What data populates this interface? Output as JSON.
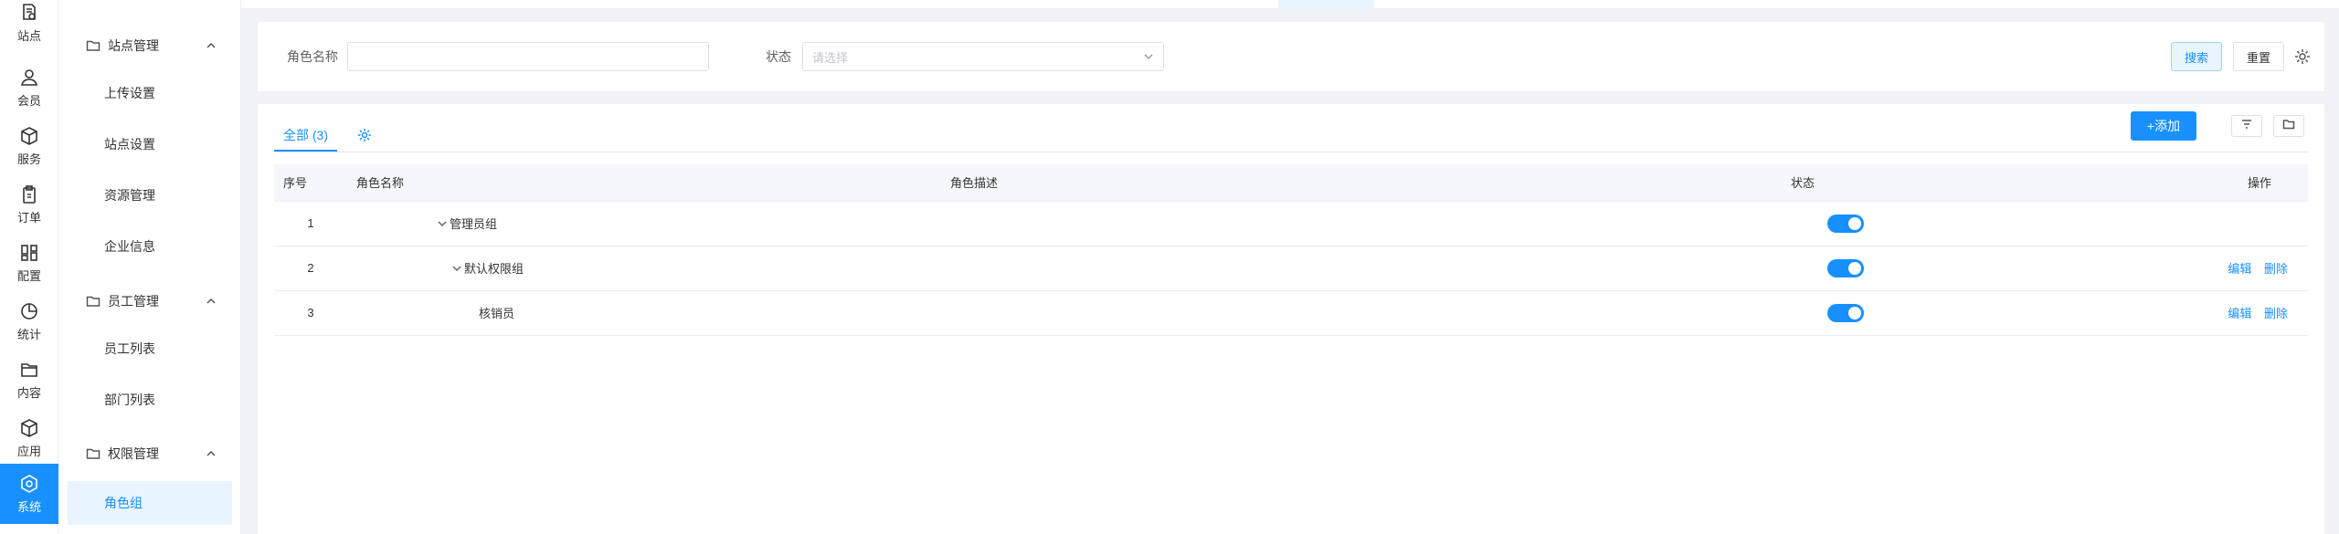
{
  "rail": {
    "items": [
      {
        "label": "站点",
        "icon": "site-doc-icon"
      },
      {
        "label": "会员",
        "icon": "user-icon"
      },
      {
        "label": "服务",
        "icon": "box-icon"
      },
      {
        "label": "订单",
        "icon": "clipboard-icon"
      },
      {
        "label": "配置",
        "icon": "grid-icon"
      },
      {
        "label": "统计",
        "icon": "pie-icon"
      },
      {
        "label": "内容",
        "icon": "folder-icon"
      },
      {
        "label": "应用",
        "icon": "cube-icon"
      },
      {
        "label": "系统",
        "icon": "hexagon-gear-icon",
        "active": true
      }
    ]
  },
  "submenu": {
    "groups": [
      {
        "title": "站点管理",
        "items": [
          "上传设置",
          "站点设置",
          "资源管理",
          "企业信息"
        ]
      },
      {
        "title": "员工管理",
        "items": [
          "员工列表",
          "部门列表"
        ]
      },
      {
        "title": "权限管理",
        "items": [
          "角色组"
        ]
      }
    ],
    "active_item": "角色组"
  },
  "search": {
    "name_label": "角色名称",
    "name_value": "",
    "status_label": "状态",
    "status_placeholder": "请选择",
    "search_button": "搜索",
    "reset_button": "重置"
  },
  "list": {
    "tab_all": "全部 (3)",
    "add_button": "+添加",
    "columns": [
      "序号",
      "角色名称",
      "角色描述",
      "状态",
      "操作"
    ],
    "rows": [
      {
        "index": "1",
        "name": "管理员组",
        "description": "",
        "status": true,
        "actions": []
      },
      {
        "index": "2",
        "name": "默认权限组",
        "description": "",
        "status": true,
        "actions": [
          "编辑",
          "删除"
        ]
      },
      {
        "index": "3",
        "name": "核销员",
        "description": "",
        "status": true,
        "actions": [
          "编辑",
          "删除"
        ]
      }
    ]
  },
  "colors": {
    "primary": "#1890ff",
    "active_bg": "#e8f4ff"
  }
}
